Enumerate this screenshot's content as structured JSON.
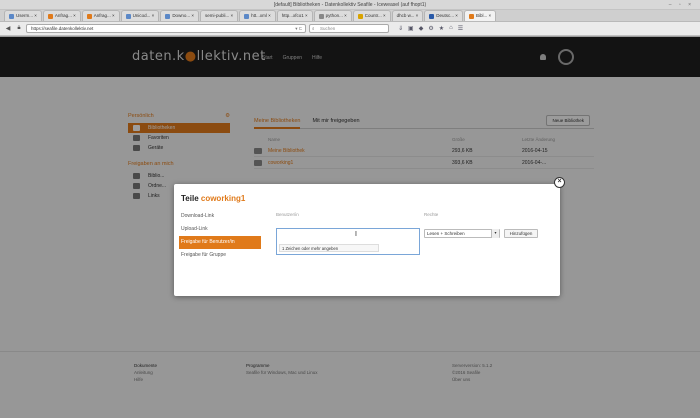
{
  "window": {
    "title": "[default] Bibliotheken - Datenkollektiv Seafile - Iceweasel (auf fhopt1)",
    "controls": "– ▫ ×"
  },
  "tabs": [
    {
      "label": "Userm... ×"
    },
    {
      "label": "Anfrag... ×"
    },
    {
      "label": "Anfrag... ×"
    },
    {
      "label": "Unicod... ×"
    },
    {
      "label": "Downo... ×"
    },
    {
      "label": "semi-publi... ×"
    },
    {
      "label": "htt...xml ×"
    },
    {
      "label": "http...xfco1 ×"
    },
    {
      "label": "python... ×"
    },
    {
      "label": "Countr... ×"
    },
    {
      "label": "dhcb w... ×"
    },
    {
      "label": "Deutsc... ×"
    },
    {
      "label": "Bibl... ×",
      "active": true
    }
  ],
  "navbar": {
    "url": "https://seafile.datenkollektiv.net",
    "search_placeholder": "Suchen"
  },
  "site": {
    "logo_left": "daten.k",
    "logo_dot": "●",
    "logo_right": "llektiv.net",
    "nav": [
      "Start",
      "Gruppen",
      "Hilfe"
    ]
  },
  "sidebar": {
    "section1": "Persönlich",
    "items1": [
      "Bibliotheken",
      "Favoriten",
      "Geräte"
    ],
    "section2": "Freigaben an mich",
    "items2": [
      "Biblio...",
      "Ordne...",
      "Links"
    ]
  },
  "main": {
    "tabs": [
      "Meine Bibliotheken",
      "Mit mir freigegeben"
    ],
    "new_library": "Neue Bibliothek",
    "columns": [
      "Name",
      "Größe",
      "Letzte Änderung"
    ],
    "rows": [
      {
        "name": "Meine Bibliothek",
        "size": "293,6 KB",
        "modified": "2016-04-15"
      },
      {
        "name": "coworking1",
        "size": "393,6 KB",
        "modified": "2016-04-..."
      }
    ]
  },
  "footer": {
    "col1": {
      "title": "Dokumente",
      "lines": [
        "Anleitung",
        "Hilfe"
      ]
    },
    "col2": {
      "title": "Programme",
      "lines": [
        "Seafile für Windows, Mac und Linux"
      ]
    },
    "col3": {
      "title": "Serverversion: 5.1.2",
      "lines": [
        "©2016 Seafile",
        "Über uns"
      ]
    }
  },
  "modal": {
    "title_prefix": "Teile",
    "title_highlight": "coworking1",
    "close": "×",
    "nav": [
      "Download-Link",
      "Upload-Link",
      "Freigabe für Benutzer/in",
      "Freigabe für Gruppe"
    ],
    "active_nav": 2,
    "user_label": "Benutzer/in",
    "perm_label": "Rechte",
    "input_hint": "1 Zeichen oder mehr angeben",
    "permission_value": "Lesen + Schreiben",
    "add_button": "Hinzufügen"
  }
}
